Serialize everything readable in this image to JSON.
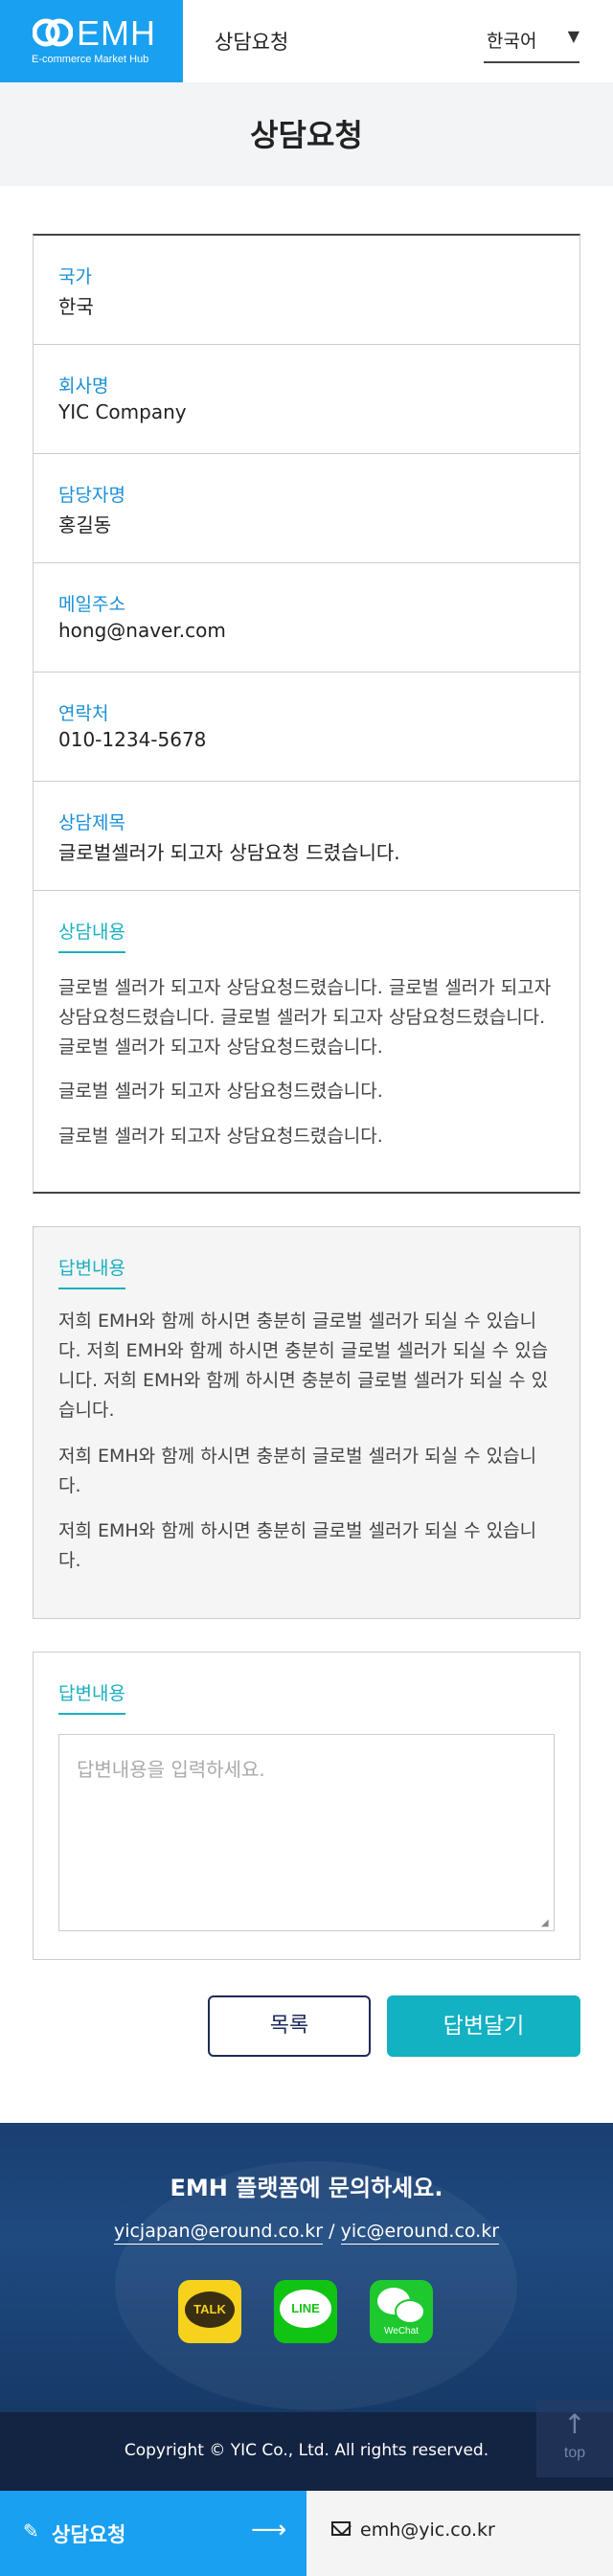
{
  "header": {
    "logo_text": "EMH",
    "logo_sub": "E-commerce Market Hub",
    "title": "상담요청",
    "language": "한국어"
  },
  "page_title": "상담요청",
  "detail": {
    "country": {
      "label": "국가",
      "value": "한국"
    },
    "company": {
      "label": "회사명",
      "value": "YIC Company"
    },
    "manager": {
      "label": "담당자명",
      "value": "홍길동"
    },
    "email": {
      "label": "메일주소",
      "value": "hong@naver.com"
    },
    "phone": {
      "label": "연락처",
      "value": "010-1234-5678"
    },
    "subject": {
      "label": "상담제목",
      "value": "글로벌셀러가 되고자 상담요청 드렸습니다."
    },
    "content": {
      "label": "상담내용",
      "paragraphs": [
        "글로벌 셀러가 되고자 상담요청드렸습니다. 글로벌 셀러가 되고자 상담요청드렸습니다. 글로벌 셀러가 되고자 상담요청드렸습니다. 글로벌 셀러가 되고자 상담요청드렸습니다.",
        "글로벌 셀러가 되고자 상담요청드렸습니다.",
        "글로벌 셀러가 되고자 상담요청드렸습니다."
      ]
    }
  },
  "answer": {
    "label": "답변내용",
    "paragraphs": [
      "저희 EMH와 함께 하시면 충분히 글로벌 셀러가 되실 수 있습니다. 저희 EMH와 함께 하시면 충분히 글로벌 셀러가 되실 수 있습니다. 저희 EMH와 함께 하시면 충분히 글로벌 셀러가 되실 수 있습니다.",
      "저희 EMH와 함께 하시면 충분히 글로벌 셀러가 되실 수 있습니다.",
      "저희 EMH와 함께 하시면 충분히 글로벌 셀러가 되실 수 있습니다."
    ]
  },
  "reply": {
    "label": "답변내용",
    "placeholder": "답변내용을 입력하세요.",
    "value": ""
  },
  "buttons": {
    "list": "목록",
    "submit": "답변달기"
  },
  "footer": {
    "title": "EMH 플랫폼에 문의하세요.",
    "email1": "yicjapan@eround.co.kr",
    "separator": "/",
    "email2": "yic@eround.co.kr",
    "sns": {
      "kakao": "TALK",
      "line": "LINE",
      "wechat": "WeChat"
    },
    "copyright": "Copyright © YIC Co., Ltd. All rights reserved.",
    "top": "top"
  },
  "bottom_bar": {
    "consult": "상담요청",
    "email": "emh@yic.co.kr"
  },
  "colors": {
    "brand_blue": "#1aa0f0",
    "accent_teal": "#12b2c2",
    "navy": "#1d2b5a"
  }
}
